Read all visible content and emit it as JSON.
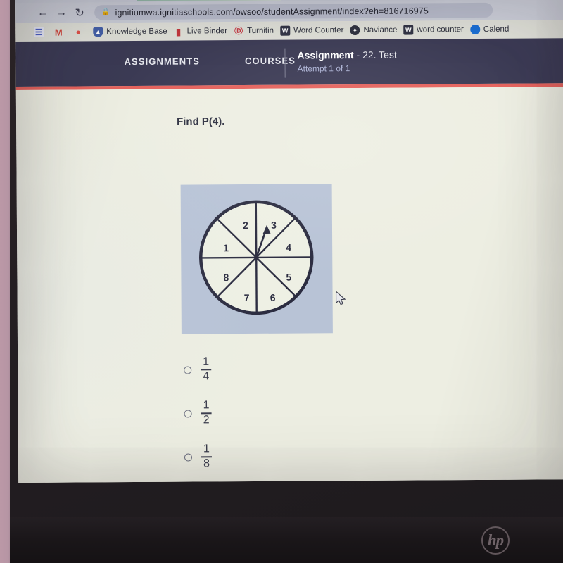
{
  "browser": {
    "nav": {
      "back": "←",
      "forward": "→",
      "reload": "↻"
    },
    "omnibox": {
      "lock_icon": "🔒",
      "url": "ignitiumwa.ignitiaschools.com/owsoo/studentAssignment/index?eh=816716975"
    },
    "bookmarks": [
      {
        "label": "",
        "icon": "reading-list-icon",
        "glyph": "☰"
      },
      {
        "label": "",
        "icon": "gmail-icon",
        "glyph": "M"
      },
      {
        "label": "",
        "icon": "flame-icon",
        "glyph": "●"
      },
      {
        "label": "Knowledge Base",
        "icon": "shield-icon",
        "glyph": "▲"
      },
      {
        "label": "Live Binder",
        "icon": "binder-icon",
        "glyph": "▮"
      },
      {
        "label": "Turnitin",
        "icon": "turnitin-icon",
        "glyph": "Ⓓ"
      },
      {
        "label": "Word Counter",
        "icon": "w-icon",
        "glyph": "W"
      },
      {
        "label": "Naviance",
        "icon": "naviance-icon",
        "glyph": "✦"
      },
      {
        "label": "word counter",
        "icon": "w-icon",
        "glyph": "W"
      },
      {
        "label": "Calend",
        "icon": "circle-icon",
        "glyph": ""
      }
    ]
  },
  "appbar": {
    "links": [
      "ASSIGNMENTS",
      "COURSES"
    ],
    "assignment_label": "Assignment",
    "assignment_name": "- 22. Test",
    "attempt": "Attempt 1 of 1",
    "accent_red": "#e5625c",
    "bar_color": "#3b3a54"
  },
  "question": {
    "prompt": "Find P(4).",
    "choices": [
      {
        "numerator": "1",
        "denominator": "4",
        "selected": false
      },
      {
        "numerator": "1",
        "denominator": "2",
        "selected": false
      },
      {
        "numerator": "1",
        "denominator": "8",
        "selected": false
      }
    ]
  },
  "spinner": {
    "background": "#b8c3d6",
    "face_color": "#eef0e4",
    "stroke": "#2b2c40",
    "sector_count": 8,
    "labels": [
      "1",
      "2",
      "3",
      "4",
      "5",
      "6",
      "7",
      "8"
    ],
    "pointer_target": "3",
    "pointer_angle_deg": -72
  },
  "taskbar": {
    "background": "#4b5068",
    "items": [
      {
        "name": "start-button",
        "icon": "windows-icon"
      },
      {
        "name": "search-button",
        "icon": "search-icon"
      },
      {
        "name": "cortana-button",
        "icon": "circle-icon"
      },
      {
        "name": "task-separator",
        "icon": "separator"
      },
      {
        "name": "file-explorer",
        "icon": "folder-icon"
      },
      {
        "name": "microsoft-store",
        "icon": "store-icon"
      },
      {
        "name": "lightning-app",
        "icon": "lightning-icon"
      },
      {
        "name": "mail-app",
        "icon": "mail-icon"
      },
      {
        "name": "google-chrome",
        "icon": "chrome-icon"
      },
      {
        "name": "microsoft-edge",
        "icon": "edge-icon"
      },
      {
        "name": "dropbox",
        "icon": "dropbox-icon"
      },
      {
        "name": "browser-shield-app",
        "icon": "shield-red-icon"
      },
      {
        "name": "security-app",
        "icon": "lock-shield-icon"
      }
    ]
  },
  "device": {
    "brand": "hp"
  }
}
